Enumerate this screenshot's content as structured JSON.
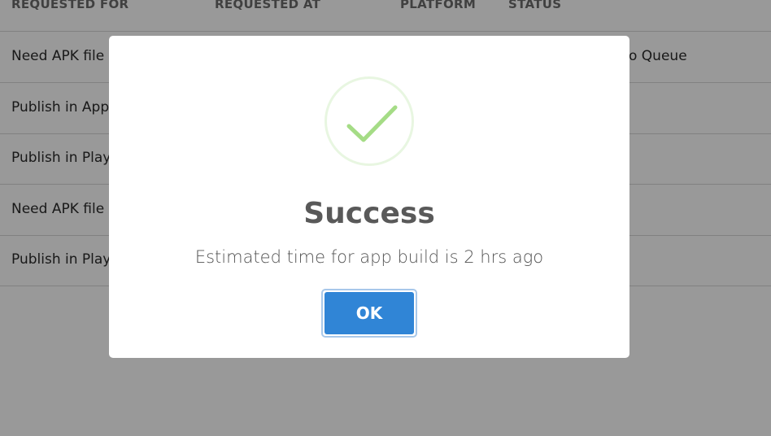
{
  "table": {
    "headers": [
      "REQUESTED FOR",
      "REQUESTED AT",
      "PLATFORM",
      "STATUS"
    ],
    "rows": [
      {
        "requested_for": "Need APK file c",
        "status": "o Queue"
      },
      {
        "requested_for": "Publish in App "
      },
      {
        "requested_for": "Publish in Play "
      },
      {
        "requested_for": "Need APK file c"
      },
      {
        "requested_for": "Publish in Play "
      }
    ]
  },
  "modal": {
    "icon": "success-check-icon",
    "title": "Success",
    "message": "Estimated time for app build is 2 hrs ago",
    "ok_label": "OK",
    "check_color": "#a5dc86",
    "button_color": "#3085d6"
  }
}
